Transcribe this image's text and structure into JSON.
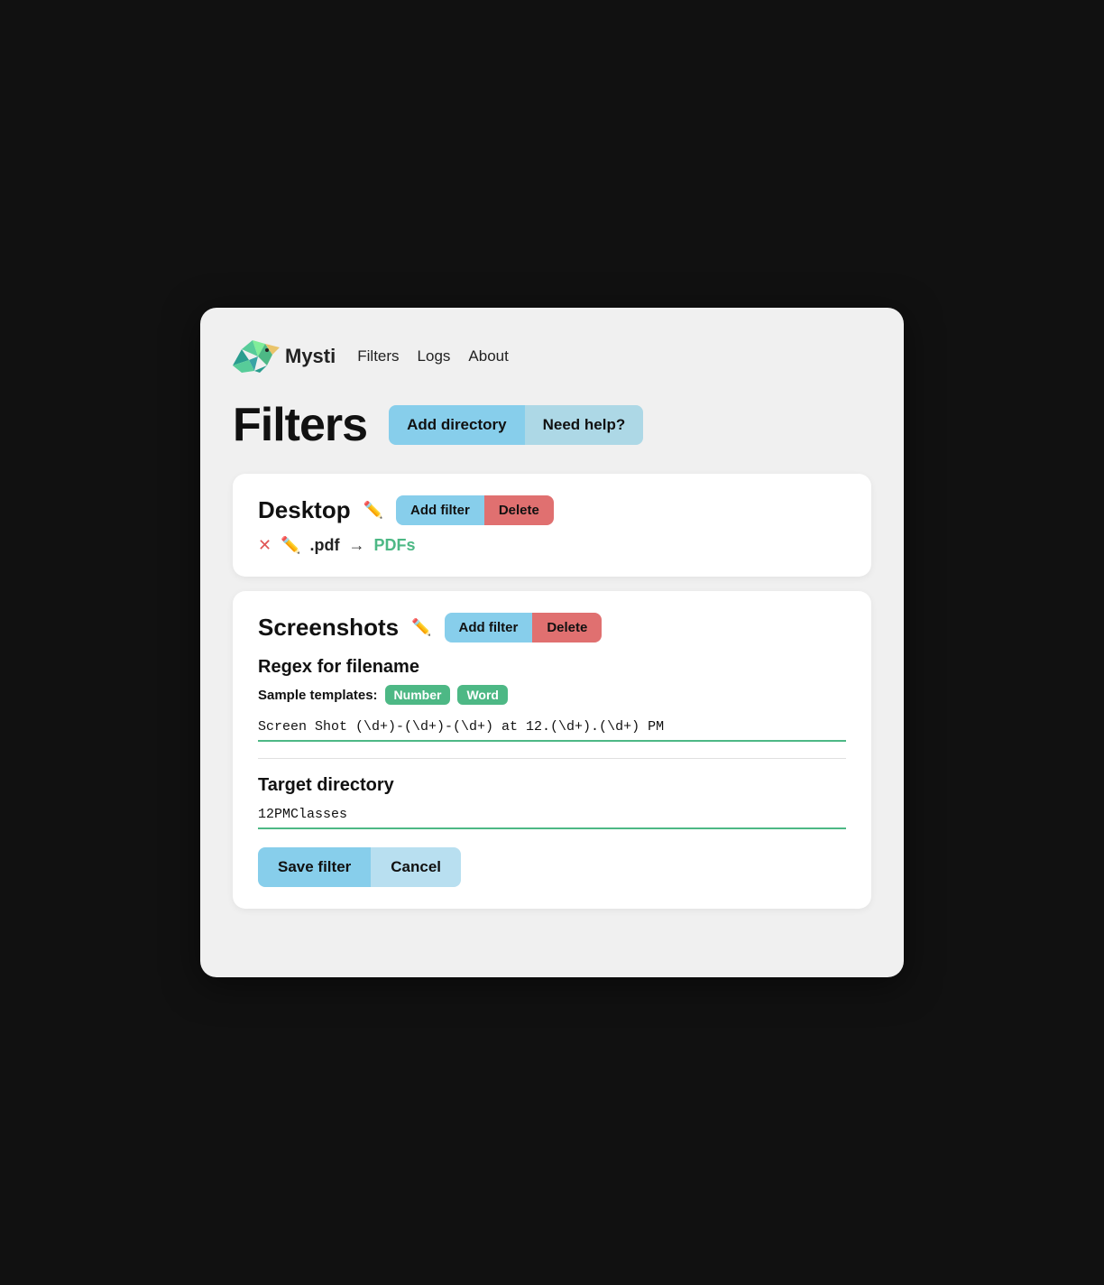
{
  "nav": {
    "logo_text": "Mysti",
    "links": [
      {
        "label": "Filters",
        "id": "filters"
      },
      {
        "label": "Logs",
        "id": "logs"
      },
      {
        "label": "About",
        "id": "about"
      }
    ]
  },
  "page": {
    "title": "Filters",
    "btn_add_directory": "Add directory",
    "btn_need_help": "Need help?"
  },
  "desktop_section": {
    "title": "Desktop",
    "btn_add_filter": "Add filter",
    "btn_delete": "Delete",
    "filter": {
      "ext": ".pdf",
      "arrow": "→",
      "dest": "PDFs"
    }
  },
  "screenshots_section": {
    "title": "Screenshots",
    "btn_add_filter": "Add filter",
    "btn_delete": "Delete",
    "regex_subsection": {
      "title": "Regex for filename",
      "sample_label": "Sample templates:",
      "tag_number": "Number",
      "tag_word": "Word",
      "regex_value": "Screen Shot (\\d+)-(\\d+)-(\\d+) at 12.(\\d+).(\\d+) PM"
    },
    "target_subsection": {
      "title": "Target directory",
      "target_value": "12PMClasses"
    },
    "btn_save_filter": "Save filter",
    "btn_cancel": "Cancel"
  }
}
